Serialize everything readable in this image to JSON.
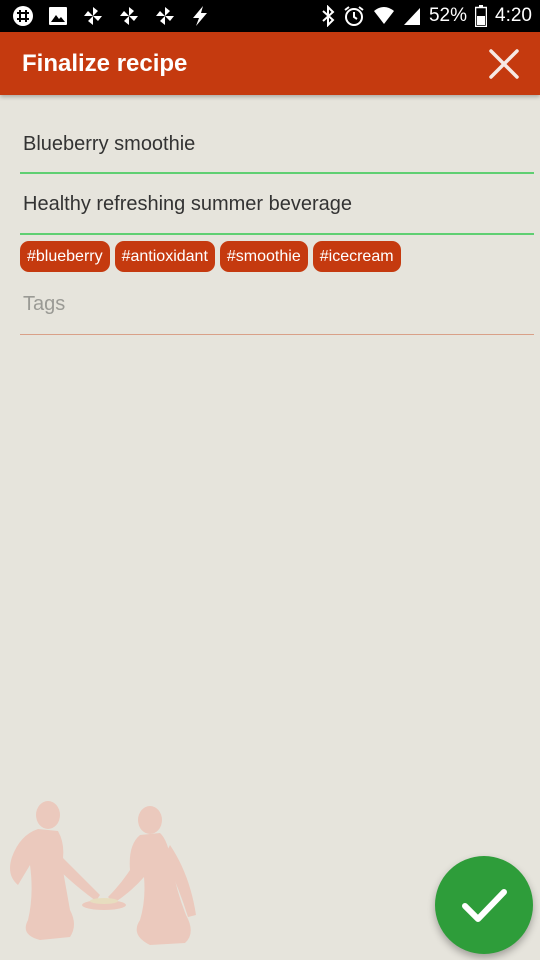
{
  "status_bar": {
    "notification_icons": [
      "slack-icon",
      "image-icon",
      "pinwheel-icon",
      "pinwheel-icon",
      "pinwheel-icon",
      "bolt-icon"
    ],
    "system_icons": [
      "bluetooth-icon",
      "alarm-icon",
      "wifi-icon",
      "signal-icon",
      "battery-icon"
    ],
    "battery": "52%",
    "time": "4:20"
  },
  "app_bar": {
    "title": "Finalize recipe",
    "close_icon": "close-icon",
    "color": "#c53a0f"
  },
  "form": {
    "title_value": "Blueberry smoothie",
    "description_value": "Healthy refreshing summer beverage",
    "tags": [
      "#blueberry",
      "#antioxidant",
      "#smoothie",
      "#icecream"
    ],
    "tags_placeholder": "Tags",
    "accent_color": "#5fcf72"
  },
  "fab": {
    "icon": "check-icon",
    "color": "#2e9d3a"
  }
}
